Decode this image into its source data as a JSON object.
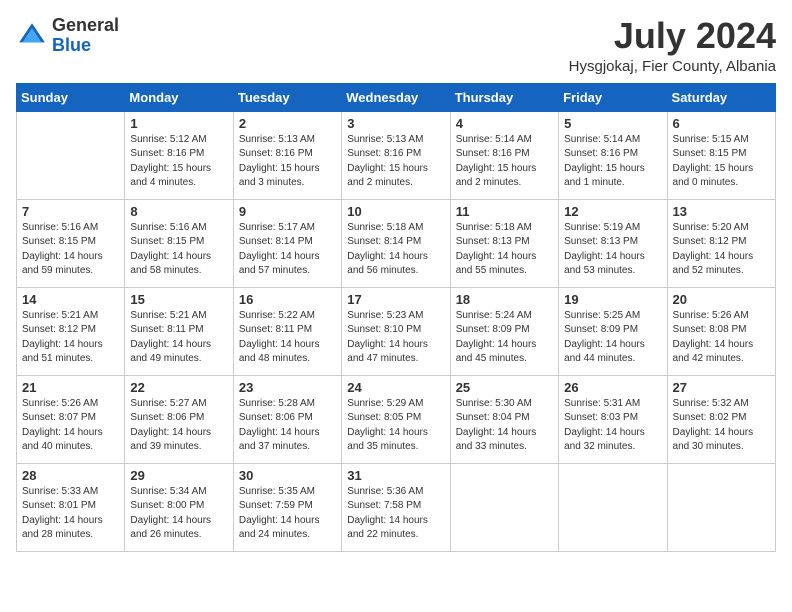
{
  "logo": {
    "general": "General",
    "blue": "Blue"
  },
  "header": {
    "month_year": "July 2024",
    "location": "Hysgjokaj, Fier County, Albania"
  },
  "days_of_week": [
    "Sunday",
    "Monday",
    "Tuesday",
    "Wednesday",
    "Thursday",
    "Friday",
    "Saturday"
  ],
  "weeks": [
    [
      {
        "day": "",
        "sunrise": "",
        "sunset": "",
        "daylight": ""
      },
      {
        "day": "1",
        "sunrise": "5:12 AM",
        "sunset": "8:16 PM",
        "daylight": "15 hours and 4 minutes."
      },
      {
        "day": "2",
        "sunrise": "5:13 AM",
        "sunset": "8:16 PM",
        "daylight": "15 hours and 3 minutes."
      },
      {
        "day": "3",
        "sunrise": "5:13 AM",
        "sunset": "8:16 PM",
        "daylight": "15 hours and 2 minutes."
      },
      {
        "day": "4",
        "sunrise": "5:14 AM",
        "sunset": "8:16 PM",
        "daylight": "15 hours and 2 minutes."
      },
      {
        "day": "5",
        "sunrise": "5:14 AM",
        "sunset": "8:16 PM",
        "daylight": "15 hours and 1 minute."
      },
      {
        "day": "6",
        "sunrise": "5:15 AM",
        "sunset": "8:15 PM",
        "daylight": "15 hours and 0 minutes."
      }
    ],
    [
      {
        "day": "7",
        "sunrise": "5:16 AM",
        "sunset": "8:15 PM",
        "daylight": "14 hours and 59 minutes."
      },
      {
        "day": "8",
        "sunrise": "5:16 AM",
        "sunset": "8:15 PM",
        "daylight": "14 hours and 58 minutes."
      },
      {
        "day": "9",
        "sunrise": "5:17 AM",
        "sunset": "8:14 PM",
        "daylight": "14 hours and 57 minutes."
      },
      {
        "day": "10",
        "sunrise": "5:18 AM",
        "sunset": "8:14 PM",
        "daylight": "14 hours and 56 minutes."
      },
      {
        "day": "11",
        "sunrise": "5:18 AM",
        "sunset": "8:13 PM",
        "daylight": "14 hours and 55 minutes."
      },
      {
        "day": "12",
        "sunrise": "5:19 AM",
        "sunset": "8:13 PM",
        "daylight": "14 hours and 53 minutes."
      },
      {
        "day": "13",
        "sunrise": "5:20 AM",
        "sunset": "8:12 PM",
        "daylight": "14 hours and 52 minutes."
      }
    ],
    [
      {
        "day": "14",
        "sunrise": "5:21 AM",
        "sunset": "8:12 PM",
        "daylight": "14 hours and 51 minutes."
      },
      {
        "day": "15",
        "sunrise": "5:21 AM",
        "sunset": "8:11 PM",
        "daylight": "14 hours and 49 minutes."
      },
      {
        "day": "16",
        "sunrise": "5:22 AM",
        "sunset": "8:11 PM",
        "daylight": "14 hours and 48 minutes."
      },
      {
        "day": "17",
        "sunrise": "5:23 AM",
        "sunset": "8:10 PM",
        "daylight": "14 hours and 47 minutes."
      },
      {
        "day": "18",
        "sunrise": "5:24 AM",
        "sunset": "8:09 PM",
        "daylight": "14 hours and 45 minutes."
      },
      {
        "day": "19",
        "sunrise": "5:25 AM",
        "sunset": "8:09 PM",
        "daylight": "14 hours and 44 minutes."
      },
      {
        "day": "20",
        "sunrise": "5:26 AM",
        "sunset": "8:08 PM",
        "daylight": "14 hours and 42 minutes."
      }
    ],
    [
      {
        "day": "21",
        "sunrise": "5:26 AM",
        "sunset": "8:07 PM",
        "daylight": "14 hours and 40 minutes."
      },
      {
        "day": "22",
        "sunrise": "5:27 AM",
        "sunset": "8:06 PM",
        "daylight": "14 hours and 39 minutes."
      },
      {
        "day": "23",
        "sunrise": "5:28 AM",
        "sunset": "8:06 PM",
        "daylight": "14 hours and 37 minutes."
      },
      {
        "day": "24",
        "sunrise": "5:29 AM",
        "sunset": "8:05 PM",
        "daylight": "14 hours and 35 minutes."
      },
      {
        "day": "25",
        "sunrise": "5:30 AM",
        "sunset": "8:04 PM",
        "daylight": "14 hours and 33 minutes."
      },
      {
        "day": "26",
        "sunrise": "5:31 AM",
        "sunset": "8:03 PM",
        "daylight": "14 hours and 32 minutes."
      },
      {
        "day": "27",
        "sunrise": "5:32 AM",
        "sunset": "8:02 PM",
        "daylight": "14 hours and 30 minutes."
      }
    ],
    [
      {
        "day": "28",
        "sunrise": "5:33 AM",
        "sunset": "8:01 PM",
        "daylight": "14 hours and 28 minutes."
      },
      {
        "day": "29",
        "sunrise": "5:34 AM",
        "sunset": "8:00 PM",
        "daylight": "14 hours and 26 minutes."
      },
      {
        "day": "30",
        "sunrise": "5:35 AM",
        "sunset": "7:59 PM",
        "daylight": "14 hours and 24 minutes."
      },
      {
        "day": "31",
        "sunrise": "5:36 AM",
        "sunset": "7:58 PM",
        "daylight": "14 hours and 22 minutes."
      },
      {
        "day": "",
        "sunrise": "",
        "sunset": "",
        "daylight": ""
      },
      {
        "day": "",
        "sunrise": "",
        "sunset": "",
        "daylight": ""
      },
      {
        "day": "",
        "sunrise": "",
        "sunset": "",
        "daylight": ""
      }
    ]
  ]
}
